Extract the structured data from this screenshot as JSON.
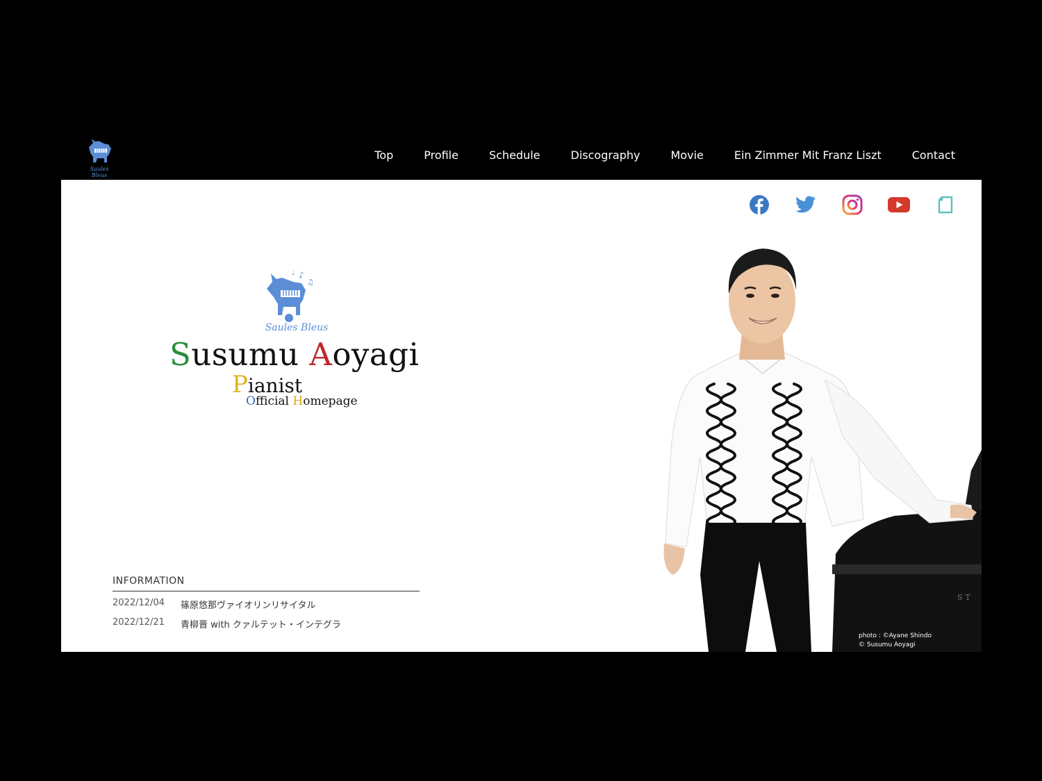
{
  "nav": {
    "logo_text": "Saules Bleus",
    "items": [
      {
        "label": "Top"
      },
      {
        "label": "Profile"
      },
      {
        "label": "Schedule"
      },
      {
        "label": "Discography"
      },
      {
        "label": "Movie"
      },
      {
        "label": "Ein Zimmer Mit Franz Liszt"
      },
      {
        "label": "Contact"
      }
    ]
  },
  "social": [
    {
      "icon": "facebook-icon",
      "color": "#3b78c4"
    },
    {
      "icon": "twitter-icon",
      "color": "#4a90d6"
    },
    {
      "icon": "instagram-icon",
      "color": "#e2386f"
    },
    {
      "icon": "youtube-icon",
      "color": "#d33a2c"
    },
    {
      "icon": "note-icon",
      "color": "#5cc2b8"
    }
  ],
  "brand": {
    "saules": "Saules Bleus",
    "name_first_initial": "S",
    "name_first_rest": "usumu ",
    "name_last_initial": "A",
    "name_last_rest": "oyagi",
    "pianist_initial": "P",
    "pianist_rest": "ianist",
    "official_initial": "O",
    "official_rest": "fficial ",
    "home_initial": "H",
    "home_rest": "omepage"
  },
  "information": {
    "title": "INFORMATION",
    "items": [
      {
        "date": "2022/12/04",
        "text": "篠原悠那ヴァイオリンリサイタル"
      },
      {
        "date": "2022/12/21",
        "text": "青柳晋 with クァルテット・インテグラ"
      }
    ]
  },
  "photo_credit": {
    "line1": "photo : ©Ayane Shindo",
    "line2": "© Susumu Aoyagi"
  },
  "colors": {
    "accent_blue": "#5b8ed6",
    "green": "#2c8c3a",
    "red": "#c0262b",
    "gold": "#e0b21e"
  }
}
